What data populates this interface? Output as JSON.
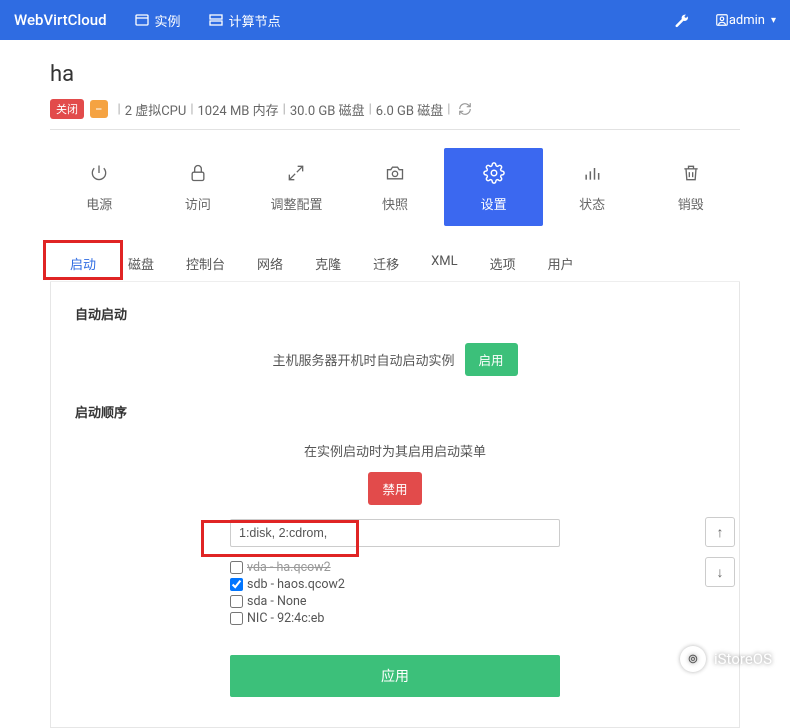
{
  "navbar": {
    "brand": "WebVirtCloud",
    "instances_label": "实例",
    "compute_label": "计算节点",
    "user_label": "admin"
  },
  "instance": {
    "name": "ha",
    "status_badge": "关闭",
    "status2_badge": "⎯",
    "vcpu_text": "2 虚拟CPU",
    "mem_text": "1024 MB 内存",
    "disk1_text": "30.0 GB 磁盘",
    "disk2_text": "6.0 GB 磁盘"
  },
  "action_tabs": {
    "power": "电源",
    "access": "访问",
    "resize": "调整配置",
    "snapshot": "快照",
    "settings": "设置",
    "status": "状态",
    "destroy": "销毁"
  },
  "sub_tabs": {
    "boot": "启动",
    "disk": "磁盘",
    "console": "控制台",
    "network": "网络",
    "clone": "克隆",
    "migrate": "迁移",
    "xml": "XML",
    "options": "选项",
    "users": "用户"
  },
  "boot": {
    "autostart_title": "自动启动",
    "autostart_desc": "主机服务器开机时自动启动实例",
    "enable_btn": "启用",
    "order_title": "启动顺序",
    "order_desc": "在实例启动时为其启用启动菜单",
    "disable_btn": "禁用",
    "order_input": "1:disk, 2:cdrom,",
    "options": [
      {
        "label": "vda - ha.qcow2",
        "checked": false,
        "strike": true
      },
      {
        "label": "sdb - haos.qcow2",
        "checked": true,
        "strike": false
      },
      {
        "label": "sda - None",
        "checked": false,
        "strike": false
      },
      {
        "label": "NIC - 92:4c:eb",
        "checked": false,
        "strike": false
      }
    ],
    "apply_btn": "应用"
  },
  "watermark": "iStoreOS"
}
